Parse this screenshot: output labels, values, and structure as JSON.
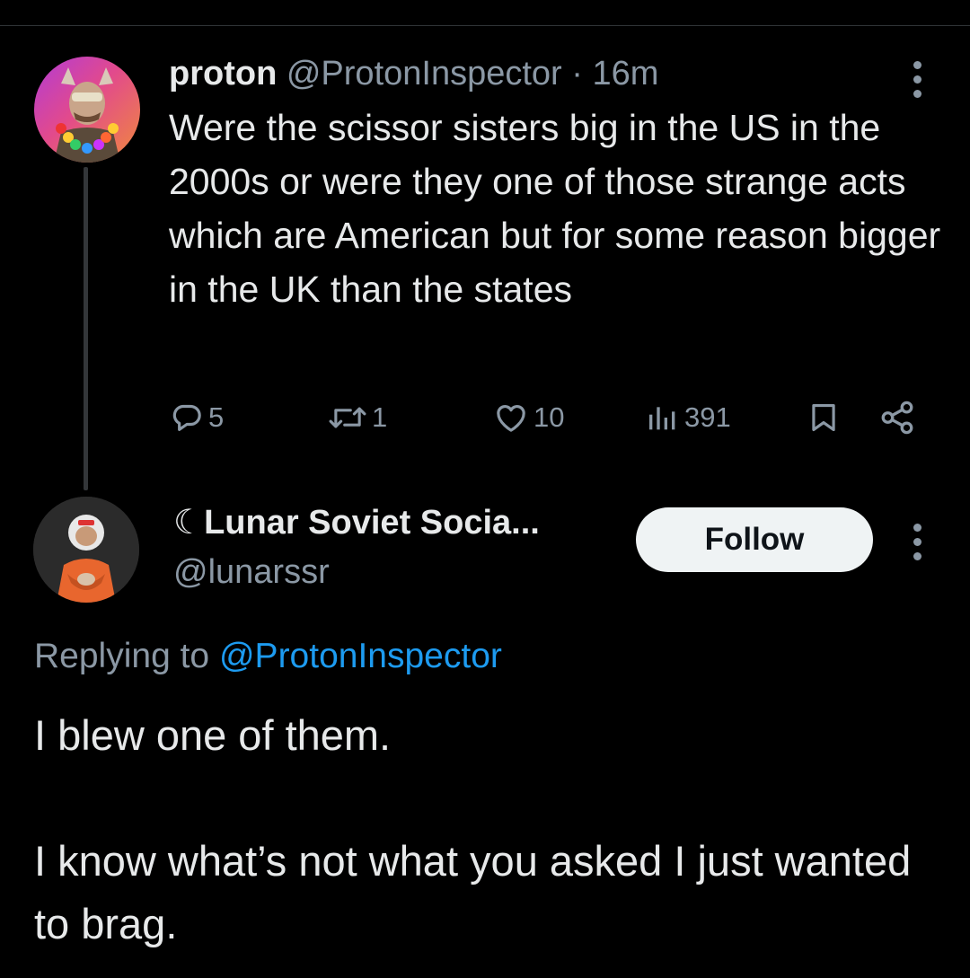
{
  "parent": {
    "name": "proton",
    "handle": "@ProtonInspector",
    "sep": "·",
    "time": "16m",
    "text": "Were the scissor sisters big in the US in the 2000s or were they one of those strange acts which are American but for some reason bigger in the UK than the states",
    "actions": {
      "replies": "5",
      "reposts": "1",
      "likes": "10",
      "views": "391"
    }
  },
  "reply": {
    "name": "☾Lunar Soviet Socia...",
    "handle": "@lunarssr",
    "follow_label": "Follow",
    "replying_prefix": "Replying to",
    "replying_to": "@ProtonInspector",
    "paragraph_1": "I blew one of them.",
    "paragraph_2": "I know what’s not what you asked I just wanted to brag."
  },
  "colors": {
    "background": "#000000",
    "text": "#e7e9ea",
    "secondary": "#8b98a5",
    "link": "#1d9bf0",
    "follow_bg": "#eff3f4"
  },
  "icons": [
    "more-icon",
    "reply-icon",
    "repost-icon",
    "like-icon",
    "views-icon",
    "bookmark-icon",
    "share-icon"
  ]
}
